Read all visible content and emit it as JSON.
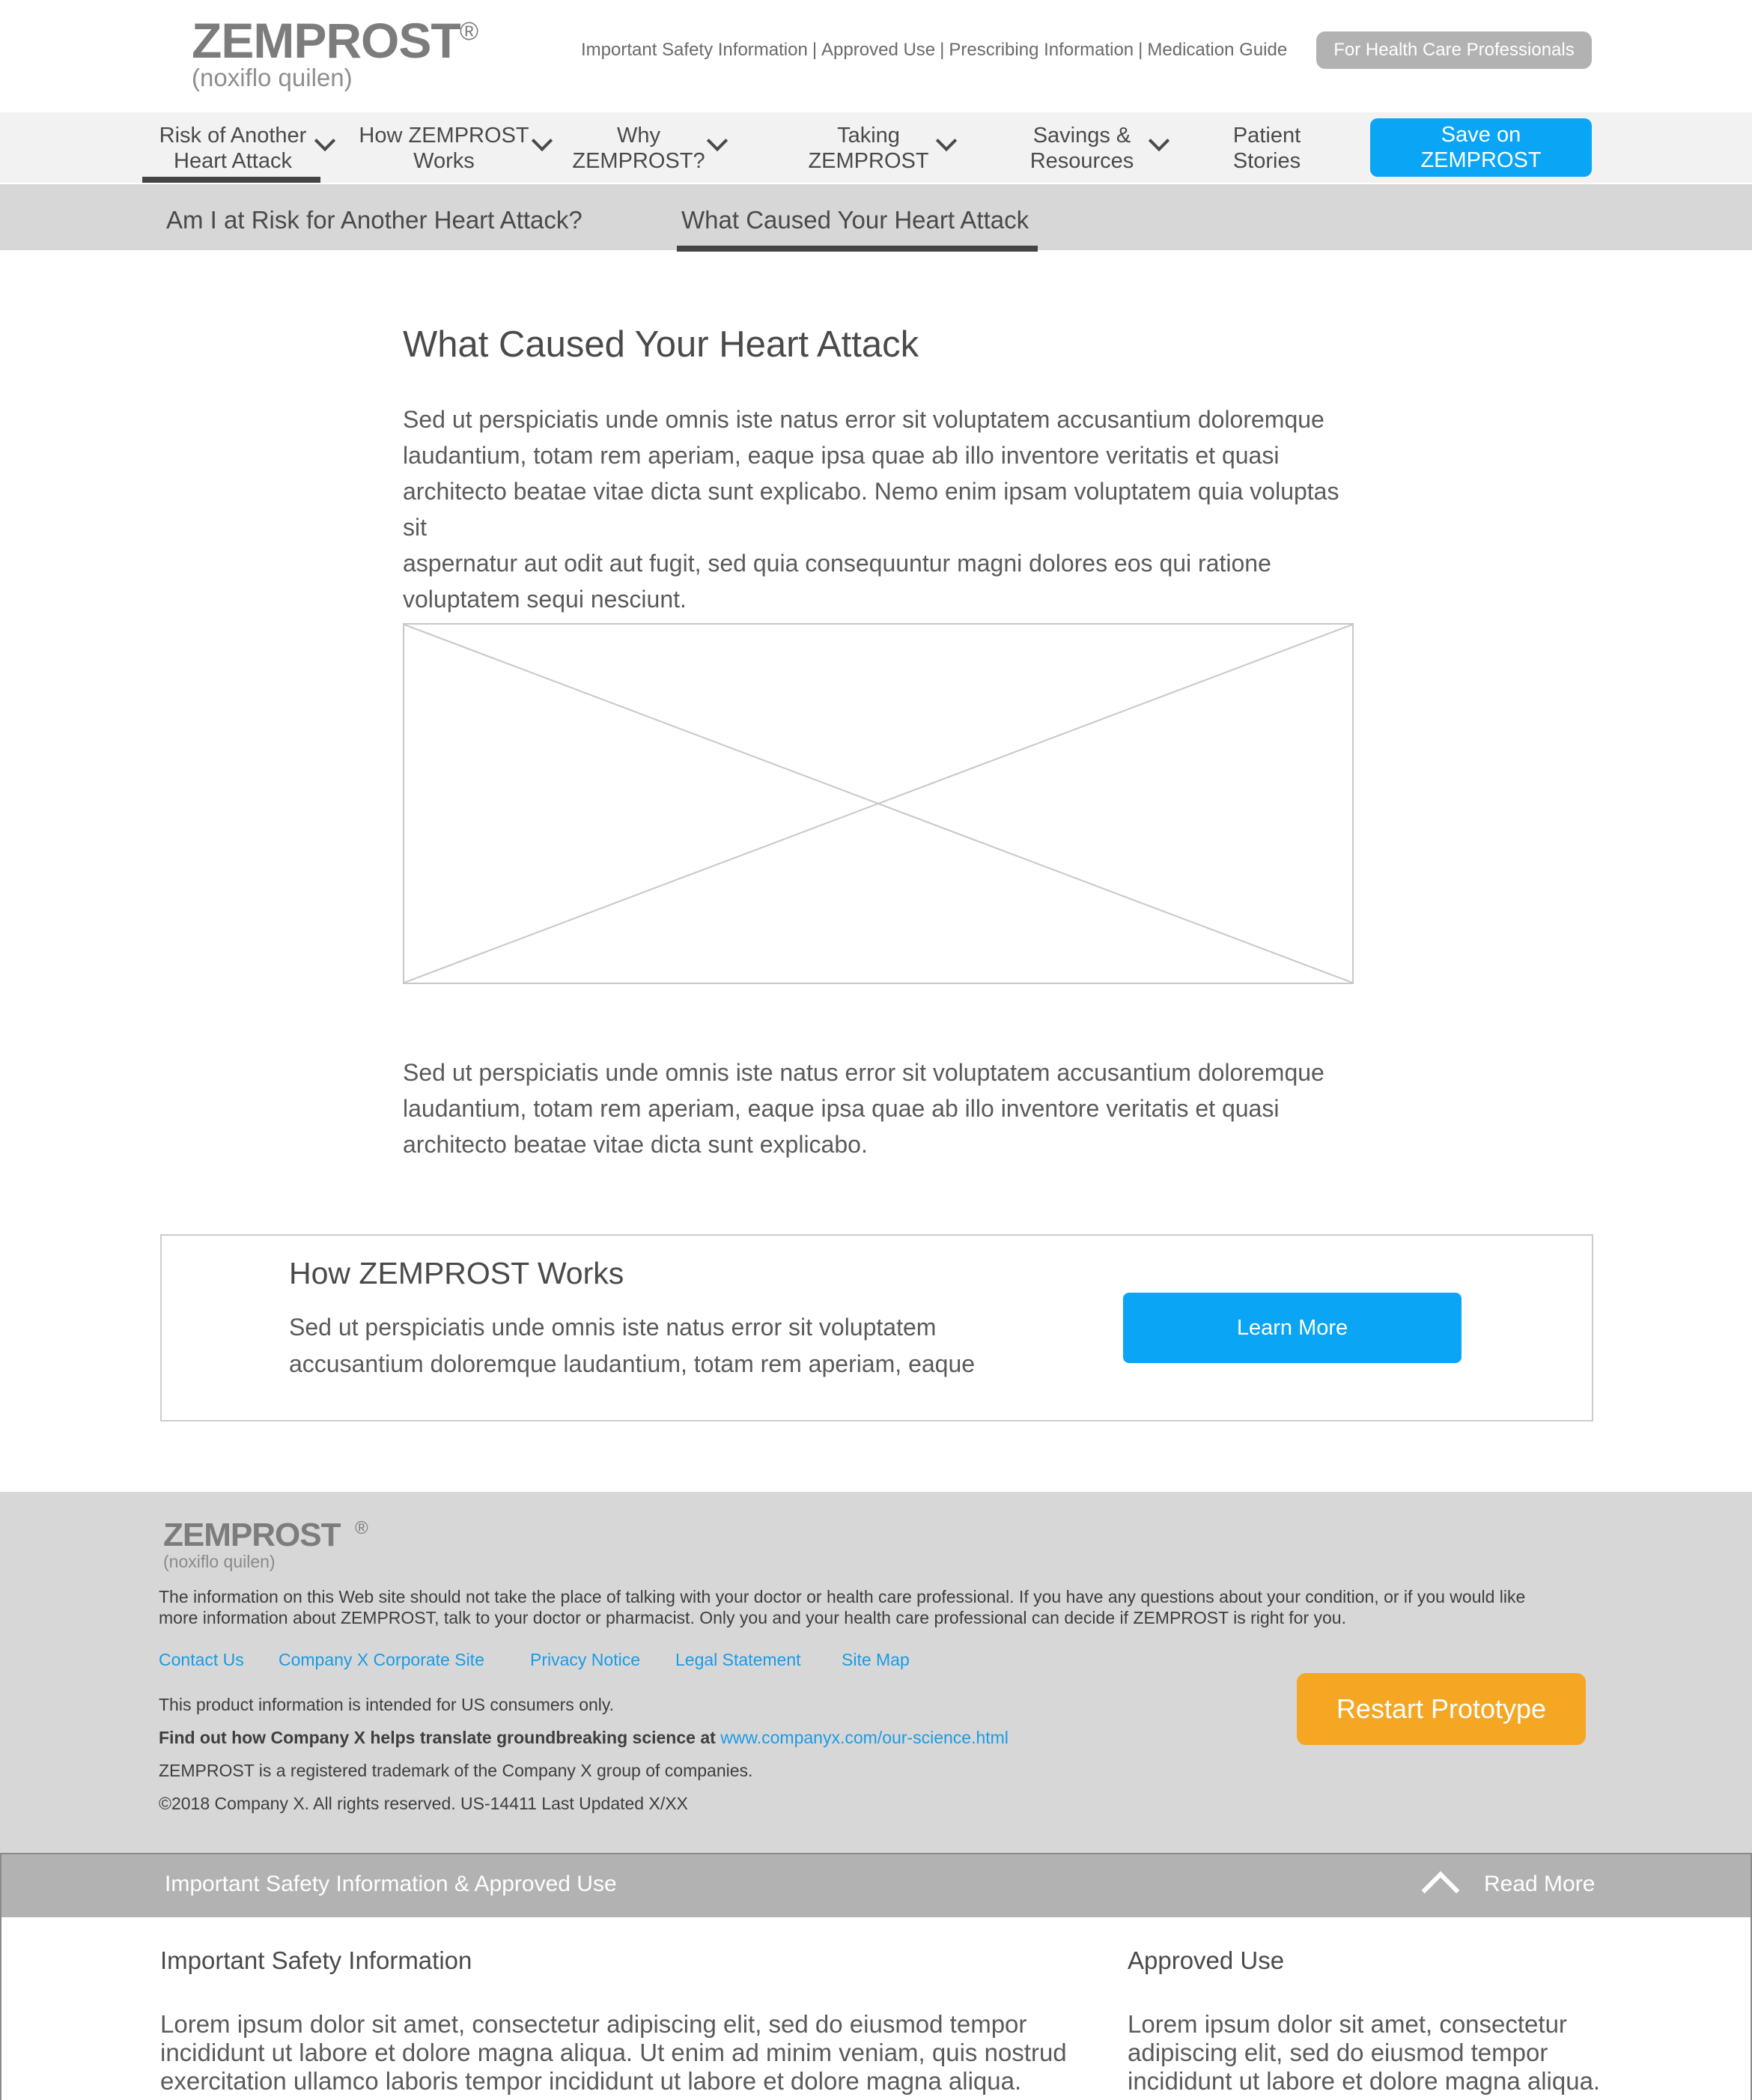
{
  "brand": {
    "name": "ZEMPROST",
    "reg": "®",
    "generic": "(noxiflo quilen)"
  },
  "util_links": [
    "Important Safety Information",
    "Approved Use",
    "Prescribing Information",
    "Medication Guide"
  ],
  "util_sep": "|",
  "hcp_button": "For Health Care Professionals",
  "nav": {
    "items": [
      {
        "line1": "Risk of Another",
        "line2": "Heart Attack"
      },
      {
        "line1": "How ZEMPROST",
        "line2": "Works"
      },
      {
        "line1": "Why",
        "line2": "ZEMPROST?"
      },
      {
        "line1": "Taking",
        "line2": "ZEMPROST"
      },
      {
        "line1": "Savings &",
        "line2": "Resources"
      },
      {
        "line1": "Patient",
        "line2": "Stories"
      }
    ],
    "save_line1": "Save on",
    "save_line2": "ZEMPROST"
  },
  "subnav": {
    "tabs": [
      "Am I at Risk for Another Heart Attack?",
      "What Caused Your Heart Attack"
    ]
  },
  "main": {
    "title": "What Caused Your Heart Attack",
    "para1": [
      "Sed ut perspiciatis unde omnis iste natus error sit voluptatem accusantium doloremque",
      "laudantium, totam rem aperiam, eaque ipsa quae ab illo inventore veritatis et quasi",
      "architecto beatae vitae dicta sunt explicabo. Nemo enim ipsam voluptatem quia voluptas sit",
      "aspernatur aut odit aut fugit, sed quia consequuntur magni dolores eos qui ratione",
      "voluptatem sequi nesciunt."
    ],
    "para2": [
      "Sed ut perspiciatis unde omnis iste natus error sit voluptatem accusantium doloremque",
      "laudantium, totam rem aperiam, eaque ipsa quae ab illo inventore veritatis et quasi",
      "architecto beatae vitae dicta sunt explicabo."
    ]
  },
  "promo": {
    "title": "How ZEMPROST Works",
    "text": [
      "Sed ut perspiciatis unde omnis iste natus error sit voluptatem",
      "accusantium doloremque laudantium, totam rem aperiam, eaque"
    ],
    "button": "Learn More"
  },
  "footer": {
    "brand": "ZEMPROST",
    "reg": "®",
    "generic": "(noxiflo quilen)",
    "disclaimer": "The information on this Web site should not take the place of talking with your doctor or health care professional. If you have any questions about your condition, or if you would like more information about ZEMPROST, talk to your doctor or pharmacist. Only you and your health care professional can decide if ZEMPROST is right for you.",
    "links": [
      "Contact Us",
      "Company X Corporate Site",
      "Privacy Notice",
      "Legal Statement",
      "Site Map"
    ],
    "us_only": "This product information is intended for US consumers only.",
    "science_bold": "Find out how Company X helps translate groundbreaking science at",
    "science_url": "www.companyx.com/our-science.html",
    "trademark": "ZEMPROST is a registered trademark of the Company X group of companies.",
    "copyright": "©2018 Company X. All rights reserved. US-14411 Last Updated X/XX",
    "restart": "Restart Prototype"
  },
  "isi": {
    "bar_title": "Important Safety Information & Approved Use",
    "read_more": "Read More",
    "left_heading": "Important Safety Information",
    "left_text": [
      "Lorem ipsum dolor sit amet, consectetur adipiscing elit, sed do eiusmod tempor",
      "incididunt ut labore et dolore magna aliqua. Ut enim ad minim veniam, quis nostrud",
      "exercitation ullamco laboris tempor incididunt ut labore et dolore magna aliqua."
    ],
    "right_heading": "Approved Use",
    "right_text": [
      "Lorem ipsum dolor sit amet, consectetur",
      "adipiscing elit, sed do eiusmod tempor",
      "incididunt ut labore et dolore magna aliqua."
    ]
  },
  "colors": {
    "accent": "#0aa5f5",
    "restart": "#f5a623",
    "nav_bg": "#f2f2f2",
    "subnav_bg": "#d7d7d7",
    "footer_bg": "#d7d7d7",
    "isi_bar": "#b2b2b2"
  }
}
